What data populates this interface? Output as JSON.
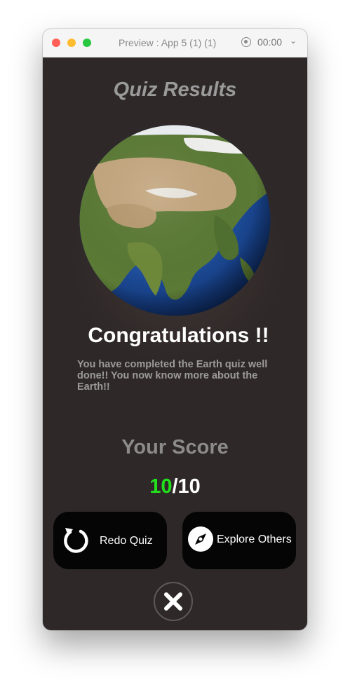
{
  "window": {
    "title": "Preview : App 5 (1) (1)",
    "timer": "00:00"
  },
  "quiz": {
    "title": "Quiz Results",
    "congrats": "Congratulations !!",
    "description": "You have completed the Earth quiz well done!! You now know more about the Earth!!",
    "score_heading": "Your Score",
    "score_value": "10",
    "score_total": "/10"
  },
  "buttons": {
    "redo_label": "Redo Quiz",
    "explore_label": "Explore Others"
  },
  "icons": {
    "redo": "redo-arrow-icon",
    "explore": "compass-icon",
    "close": "close-x-icon",
    "record": "record-icon",
    "chevron": "chevron-down-icon"
  },
  "colors": {
    "background": "#2e2829",
    "score_green": "#22e01c",
    "button_bg": "#050505"
  }
}
